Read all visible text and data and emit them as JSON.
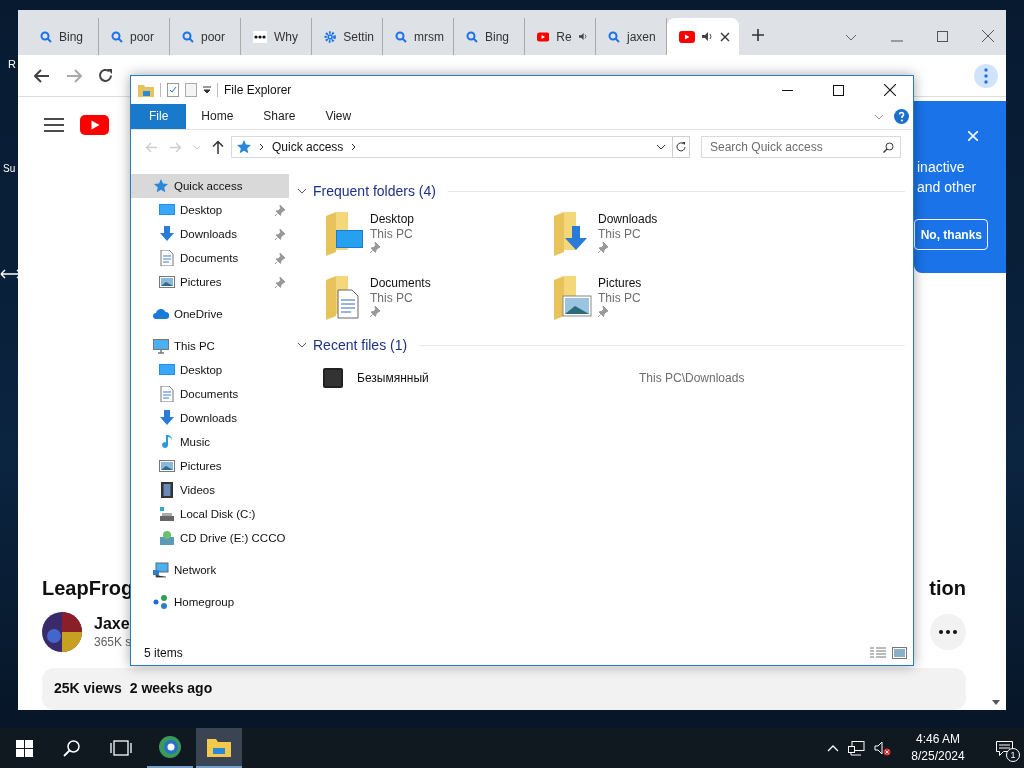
{
  "desktop": {
    "icon_labels": [
      "R",
      "Su"
    ]
  },
  "browser": {
    "tabs": [
      {
        "title": "Bing",
        "kind": "search",
        "audio": false,
        "selected": false
      },
      {
        "title": "poor",
        "kind": "search",
        "audio": false,
        "selected": false
      },
      {
        "title": "poor",
        "kind": "search",
        "audio": false,
        "selected": false
      },
      {
        "title": "Why",
        "kind": "dots",
        "audio": false,
        "selected": false
      },
      {
        "title": "Settin",
        "kind": "gear",
        "audio": false,
        "selected": false
      },
      {
        "title": "mrsm",
        "kind": "search",
        "audio": false,
        "selected": false
      },
      {
        "title": "Bing",
        "kind": "search",
        "audio": false,
        "selected": false
      },
      {
        "title": "Re",
        "kind": "youtube",
        "audio": true,
        "selected": false
      },
      {
        "title": "jaxen",
        "kind": "search",
        "audio": false,
        "selected": false
      },
      {
        "kind": "youtube",
        "audio": true,
        "selected": true
      }
    ],
    "page": {
      "title_start": "LeapFrog",
      "title_end": "tion",
      "channel": "Jaxe",
      "subscribers": "365K s",
      "views": "25K views",
      "age": "2 weeks ago",
      "popup": {
        "lines": [
          "inactive",
          "and other"
        ],
        "button": "No, thanks"
      }
    }
  },
  "explorer": {
    "title": "File Explorer",
    "ribbon_tabs": [
      {
        "label": "File",
        "selected": true
      },
      {
        "label": "Home",
        "selected": false
      },
      {
        "label": "Share",
        "selected": false
      },
      {
        "label": "View",
        "selected": false
      }
    ],
    "address": "Quick access",
    "search": {
      "placeholder": "Search Quick access"
    },
    "nav": [
      {
        "label": "Quick access",
        "kind": "star",
        "selected": true,
        "children": [
          {
            "label": "Desktop",
            "kind": "desktop",
            "pinned": true
          },
          {
            "label": "Downloads",
            "kind": "download",
            "pinned": true
          },
          {
            "label": "Documents",
            "kind": "document",
            "pinned": true
          },
          {
            "label": "Pictures",
            "kind": "picture",
            "pinned": true
          }
        ]
      },
      {
        "label": "OneDrive",
        "kind": "cloud",
        "selected": false
      },
      {
        "label": "This PC",
        "kind": "pc",
        "selected": false,
        "children": [
          {
            "label": "Desktop",
            "kind": "desktop"
          },
          {
            "label": "Documents",
            "kind": "document"
          },
          {
            "label": "Downloads",
            "kind": "download"
          },
          {
            "label": "Music",
            "kind": "music"
          },
          {
            "label": "Pictures",
            "kind": "picture"
          },
          {
            "label": "Videos",
            "kind": "video"
          },
          {
            "label": "Local Disk (C:)",
            "kind": "disk"
          },
          {
            "label": "CD Drive (E:) CCCO",
            "kind": "cd"
          }
        ]
      },
      {
        "label": "Network",
        "kind": "network",
        "selected": false
      },
      {
        "label": "Homegroup",
        "kind": "homegroup",
        "selected": false
      }
    ],
    "frequent": {
      "title": "Frequent folders (4)",
      "expanded": true,
      "items": [
        {
          "name": "Desktop",
          "location": "This PC",
          "kind": "desktop",
          "pinned": true
        },
        {
          "name": "Downloads",
          "location": "This PC",
          "kind": "download",
          "pinned": true
        },
        {
          "name": "Documents",
          "location": "This PC",
          "kind": "document",
          "pinned": true
        },
        {
          "name": "Pictures",
          "location": "This PC",
          "kind": "picture",
          "pinned": true
        }
      ]
    },
    "recent": {
      "title": "Recent files (1)",
      "expanded": true,
      "items": [
        {
          "name": "Безымянный",
          "location": "This PC\\Downloads"
        }
      ]
    },
    "status": "5 items"
  },
  "taskbar": {
    "apps": [
      {
        "kind": "browser",
        "selected": false
      },
      {
        "kind": "explorer",
        "selected": true
      }
    ],
    "time": "4:46 AM",
    "date": "8/25/2024",
    "notifications": "1"
  }
}
